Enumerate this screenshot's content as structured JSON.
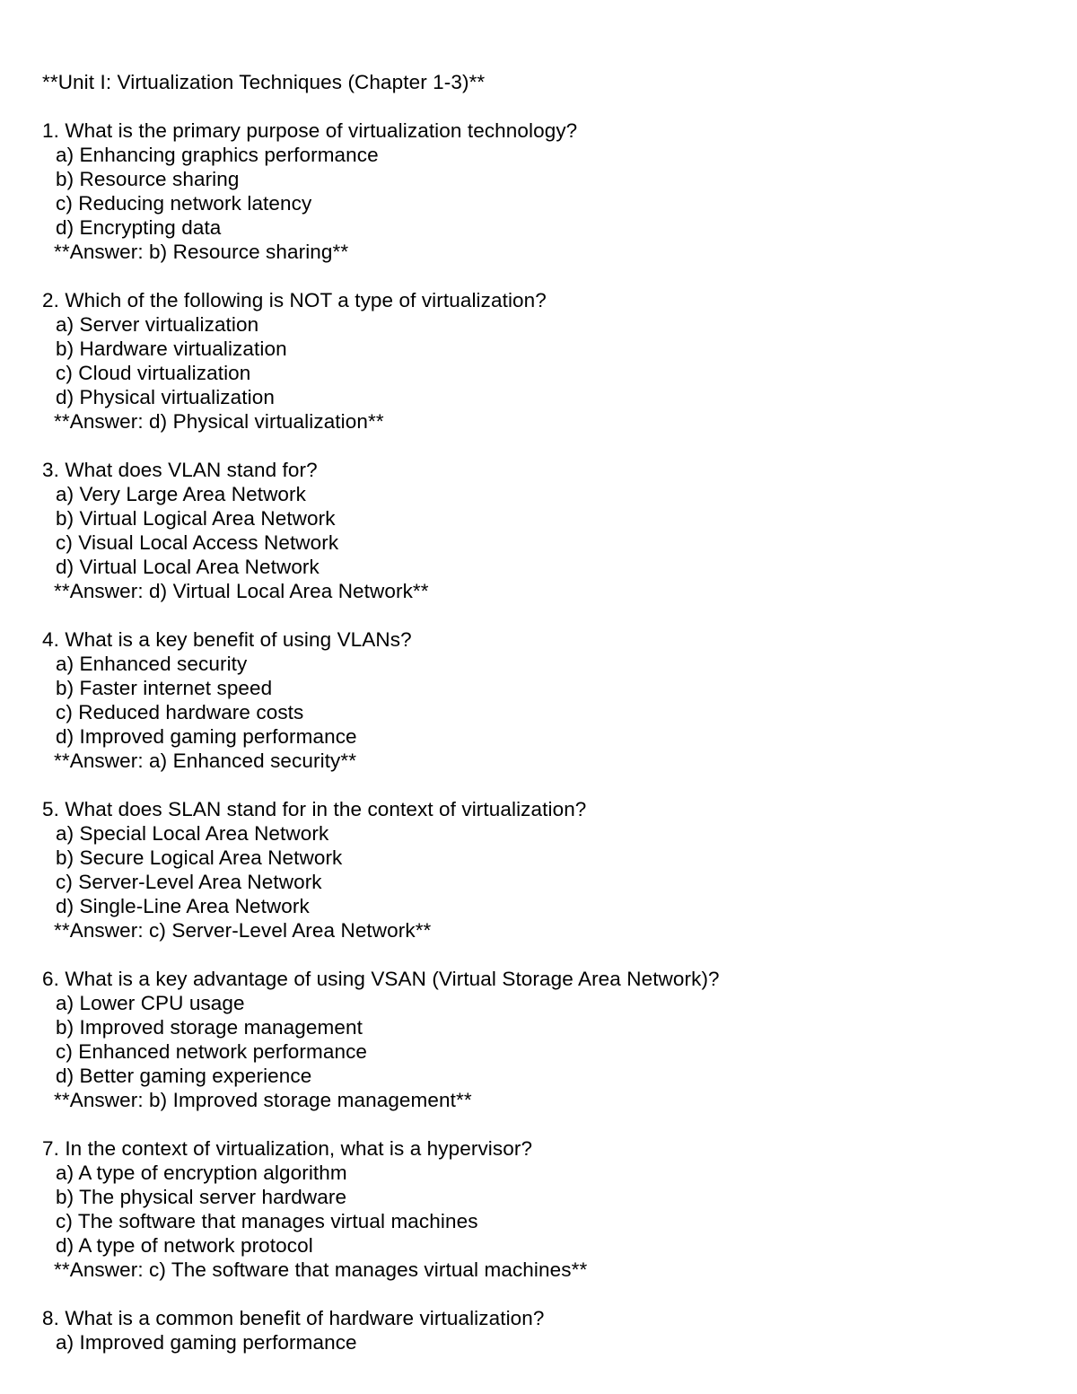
{
  "document": {
    "title": "**Unit I: Virtualization Techniques (Chapter 1-3)**",
    "questions": [
      {
        "stem": "1. What is the primary purpose of virtualization technology?",
        "options": [
          "a) Enhancing graphics performance",
          "b) Resource sharing",
          "c) Reducing network latency",
          "d) Encrypting data"
        ],
        "answer": "**Answer: b) Resource sharing**"
      },
      {
        "stem": "2. Which of the following is NOT a type of virtualization?",
        "options": [
          "a) Server virtualization",
          "b) Hardware virtualization",
          "c) Cloud virtualization",
          "d) Physical virtualization"
        ],
        "answer": "**Answer: d) Physical virtualization**"
      },
      {
        "stem": "3. What does VLAN stand for?",
        "options": [
          "a) Very Large Area Network",
          "b) Virtual Logical Area Network",
          "c) Visual Local Access Network",
          "d) Virtual Local Area Network"
        ],
        "answer": "**Answer: d) Virtual Local Area Network**"
      },
      {
        "stem": "4. What is a key benefit of using VLANs?",
        "options": [
          "a) Enhanced security",
          "b) Faster internet speed",
          "c) Reduced hardware costs",
          "d) Improved gaming performance"
        ],
        "answer": "**Answer: a) Enhanced security**"
      },
      {
        "stem": "5. What does SLAN stand for in the context of virtualization?",
        "options": [
          "a) Special Local Area Network",
          "b) Secure Logical Area Network",
          "c) Server-Level Area Network",
          "d) Single-Line Area Network"
        ],
        "answer": "**Answer: c) Server-Level Area Network**"
      },
      {
        "stem": "6. What is a key advantage of using VSAN (Virtual Storage Area Network)?",
        "options": [
          "a) Lower CPU usage",
          "b) Improved storage management",
          "c) Enhanced network performance",
          "d) Better gaming experience"
        ],
        "answer": "**Answer: b) Improved storage management**"
      },
      {
        "stem": "7. In the context of virtualization, what is a hypervisor?",
        "options": [
          "a) A type of encryption algorithm",
          "b) The physical server hardware",
          "c) The software that manages virtual machines",
          "d) A type of network protocol"
        ],
        "answer": "**Answer: c) The software that manages virtual machines**"
      },
      {
        "stem": "8. What is a common benefit of hardware virtualization?",
        "options": [
          "a) Improved gaming performance"
        ],
        "answer": ""
      }
    ]
  }
}
